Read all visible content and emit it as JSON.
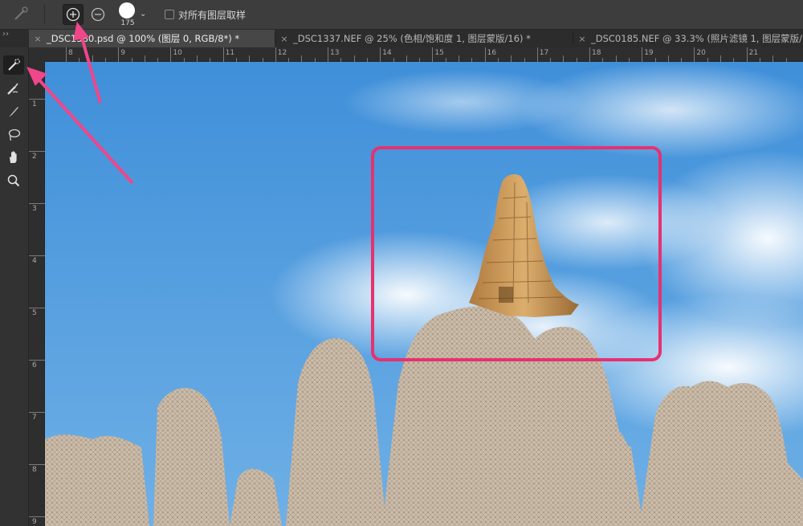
{
  "options_bar": {
    "tool_icon": "quick-selection-brush-icon",
    "new_selection_icon": "add-to-selection-icon",
    "subtract_icon": "subtract-from-selection-icon",
    "brush_size": "175",
    "sample_all_layers_label": "对所有图层取样",
    "sample_all_layers_checked": false
  },
  "panel_collapse_glyph": "››",
  "tabs": [
    {
      "label": "_DSC1380.psd @ 100% (图层 0, RGB/8*) *",
      "active": true,
      "close": "×"
    },
    {
      "label": "_DSC1337.NEF @ 25% (色相/饱和度 1, 图层蒙版/16) *",
      "active": false,
      "close": "×"
    },
    {
      "label": "_DSC0185.NEF @ 33.3% (照片滤镜 1, 图层蒙版/16) *",
      "active": false,
      "close": "×"
    }
  ],
  "tools": [
    {
      "name": "quick-selection-icon",
      "active": true
    },
    {
      "name": "refine-edge-brush-icon",
      "active": false
    },
    {
      "name": "brush-icon",
      "active": false
    },
    {
      "name": "lasso-icon",
      "active": false
    },
    {
      "name": "hand-icon",
      "active": false
    },
    {
      "name": "zoom-icon",
      "active": false
    }
  ],
  "ruler_top_labels": [
    "8",
    "9",
    "10",
    "11",
    "12",
    "13",
    "14",
    "15",
    "16",
    "17",
    "18",
    "19",
    "20",
    "21"
  ],
  "ruler_left_labels": [
    "1",
    "2",
    "3",
    "4",
    "5",
    "6",
    "7",
    "8",
    "9"
  ],
  "annotation": {
    "highlight_color": "#e8316f",
    "arrow_color": "#f0468a"
  },
  "colors": {
    "sky": "#4a93d6",
    "stone": "#c99a5c",
    "selection_mask": "#c7b8a8"
  }
}
